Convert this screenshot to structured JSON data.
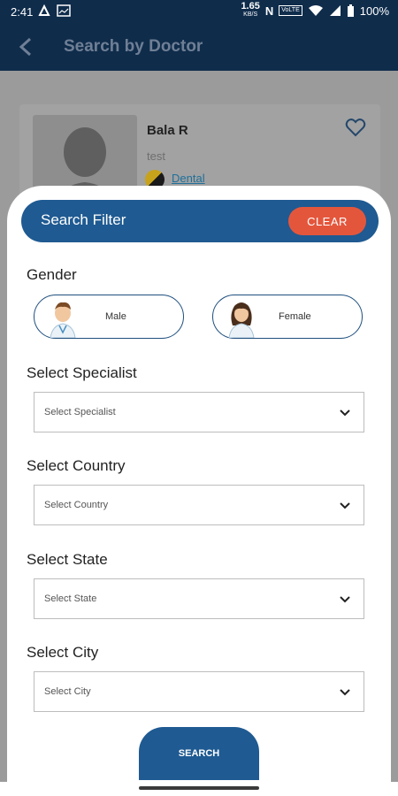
{
  "status_bar": {
    "time": "2:41",
    "net_speed": "1.65",
    "net_speed_unit": "KB/S",
    "network_badge": "N",
    "volte_label": "VoLTE",
    "battery": "100%"
  },
  "app_bar": {
    "title": "Search by Doctor"
  },
  "doctor_card": {
    "name": "Bala R",
    "subtitle": "test",
    "department": "Dental"
  },
  "filter": {
    "title": "Search Filter",
    "clear_label": "CLEAR",
    "gender_label": "Gender",
    "gender_options": [
      "Male",
      "Female"
    ],
    "specialist_label": "Select Specialist",
    "specialist_placeholder": "Select Specialist",
    "country_label": "Select Country",
    "country_placeholder": "Select Country",
    "state_label": "Select State",
    "state_placeholder": "Select State",
    "city_label": "Select City",
    "city_placeholder": "Select City",
    "search_label": "SEARCH"
  },
  "colors": {
    "primary": "#1f5a92",
    "app_bar": "#0f2c4b",
    "clear": "#e4563c"
  }
}
